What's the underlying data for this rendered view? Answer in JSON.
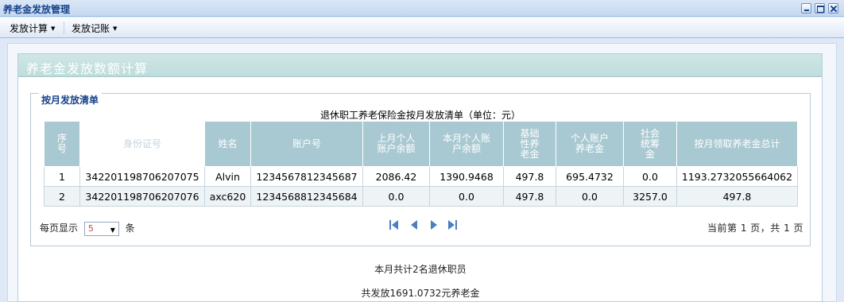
{
  "window": {
    "title": "养老金发放管理"
  },
  "menu": {
    "items": [
      {
        "label": "发放计算"
      },
      {
        "label": "发放记账"
      }
    ]
  },
  "panel": {
    "title": "养老金发放数额计算"
  },
  "group": {
    "legend": "按月发放清单"
  },
  "table": {
    "caption": "退休职工养老保险金按月发放清单（单位：元）",
    "headers": [
      "序号",
      "身份证号",
      "姓名",
      "账户号",
      "上月个人账户余额",
      "本月个人账户余额",
      "基础性养老金",
      "个人账户养老金",
      "社会统筹金",
      "按月领取养老金总计"
    ],
    "rows": [
      [
        "1",
        "342201198706207075",
        "Alvin",
        "1234567812345687",
        "2086.42",
        "1390.9468",
        "497.8",
        "695.4732",
        "0.0",
        "1193.2732055664062"
      ],
      [
        "2",
        "342201198706207076",
        "axc620",
        "1234568812345684",
        "0.0",
        "0.0",
        "497.8",
        "0.0",
        "3257.0",
        "497.8"
      ]
    ]
  },
  "pager": {
    "per_page_label": "每页显示",
    "per_page_value": "5",
    "per_page_unit": "条",
    "status": "当前第 1 页，共 1 页"
  },
  "summary": {
    "line1": "本月共计2名退休职员",
    "line2": "共发放1691.0732元养老金"
  }
}
